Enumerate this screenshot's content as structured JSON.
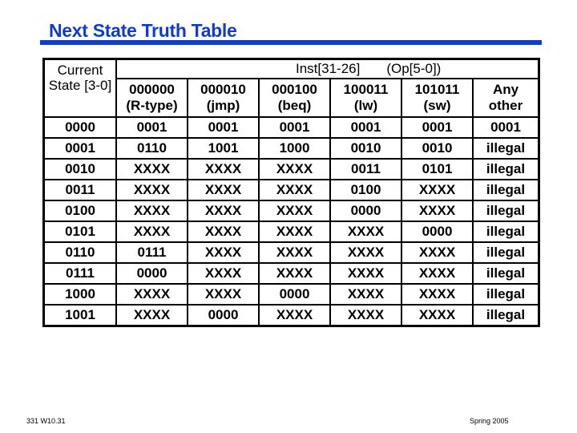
{
  "title": "Next State Truth Table",
  "table": {
    "state_header": "Current State [3-0]",
    "inst_header": "Inst[31-26]",
    "op_header": "(Op[5-0])",
    "op_columns": [
      {
        "code": "000000",
        "name": "(R-type)"
      },
      {
        "code": "000010",
        "name": "(jmp)"
      },
      {
        "code": "000100",
        "name": "(beq)"
      },
      {
        "code": "100011",
        "name": "(lw)"
      },
      {
        "code": "101011",
        "name": "(sw)"
      },
      {
        "code": "Any",
        "name": "other"
      }
    ],
    "rows": [
      {
        "state": "0000",
        "next": [
          "0001",
          "0001",
          "0001",
          "0001",
          "0001",
          "0001"
        ]
      },
      {
        "state": "0001",
        "next": [
          "0110",
          "1001",
          "1000",
          "0010",
          "0010",
          "illegal"
        ]
      },
      {
        "state": "0010",
        "next": [
          "XXXX",
          "XXXX",
          "XXXX",
          "0011",
          "0101",
          "illegal"
        ]
      },
      {
        "state": "0011",
        "next": [
          "XXXX",
          "XXXX",
          "XXXX",
          "0100",
          "XXXX",
          "illegal"
        ]
      },
      {
        "state": "0100",
        "next": [
          "XXXX",
          "XXXX",
          "XXXX",
          "0000",
          "XXXX",
          "illegal"
        ]
      },
      {
        "state": "0101",
        "next": [
          "XXXX",
          "XXXX",
          "XXXX",
          "XXXX",
          "0000",
          "illegal"
        ]
      },
      {
        "state": "0110",
        "next": [
          "0111",
          "XXXX",
          "XXXX",
          "XXXX",
          "XXXX",
          "illegal"
        ]
      },
      {
        "state": "0111",
        "next": [
          "0000",
          "XXXX",
          "XXXX",
          "XXXX",
          "XXXX",
          "illegal"
        ]
      },
      {
        "state": "1000",
        "next": [
          "XXXX",
          "XXXX",
          "0000",
          "XXXX",
          "XXXX",
          "illegal"
        ]
      },
      {
        "state": "1001",
        "next": [
          "XXXX",
          "0000",
          "XXXX",
          "XXXX",
          "XXXX",
          "illegal"
        ]
      }
    ]
  },
  "footer": {
    "left": "331  W10.31",
    "right": "Spring 2005"
  },
  "colors": {
    "title": "#0f3cc9",
    "rule": "#0f3cc9"
  }
}
